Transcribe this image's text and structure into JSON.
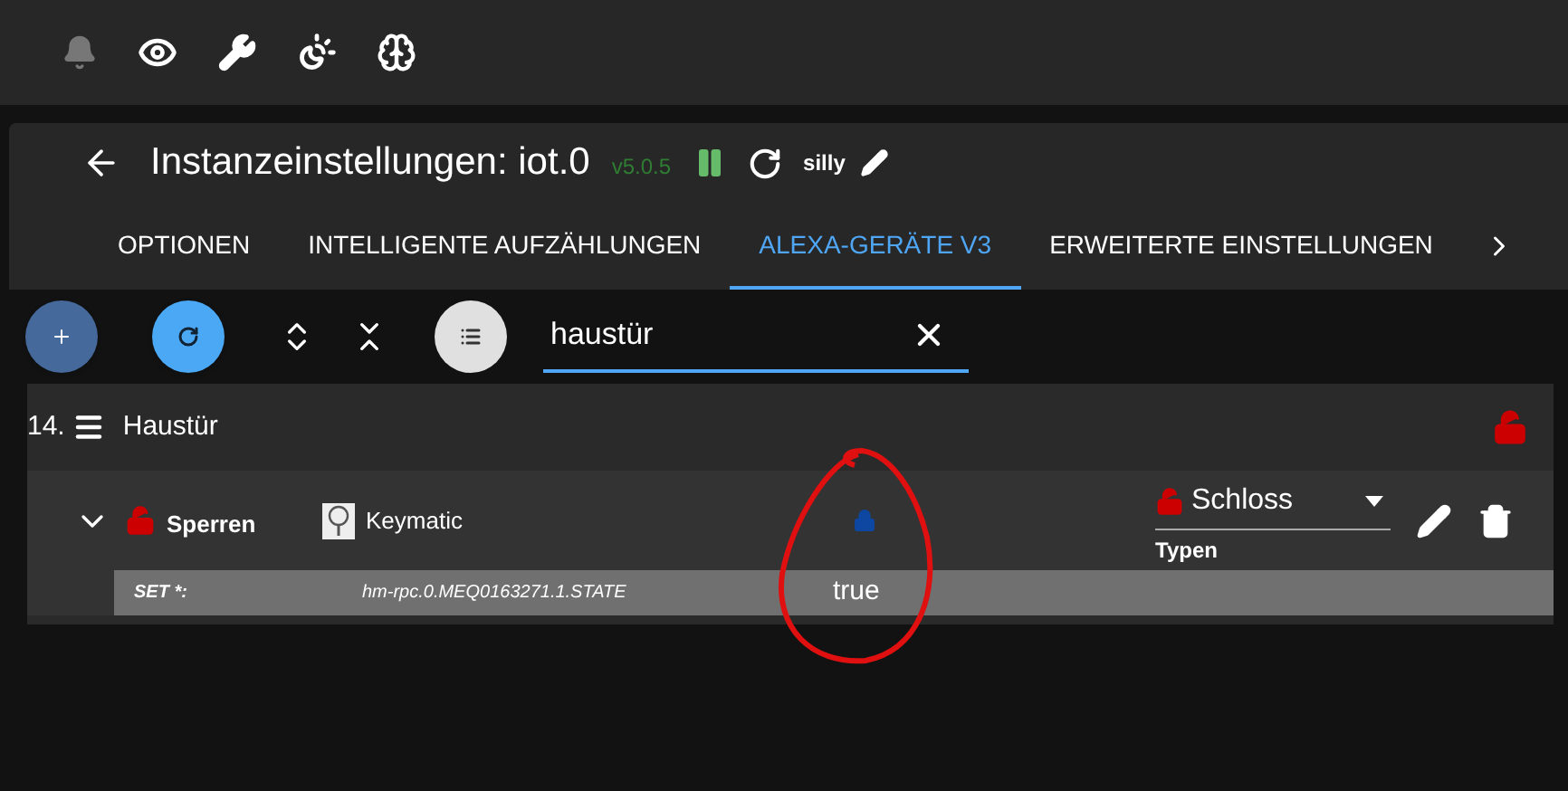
{
  "header": {
    "title": "Instanzeinstellungen: iot.0",
    "version": "v5.0.5",
    "running": true,
    "log_level": "silly"
  },
  "tabs": [
    {
      "label": "OPTIONEN",
      "selected": false
    },
    {
      "label": "INTELLIGENTE AUFZÄHLUNGEN",
      "selected": false
    },
    {
      "label": "ALEXA-GERÄTE V3",
      "selected": true
    },
    {
      "label": "ERWEITERTE EINSTELLUNGEN",
      "selected": false
    }
  ],
  "search": {
    "value": "haustür"
  },
  "group": {
    "number": "14.",
    "name": "Haustür",
    "locked": false,
    "devices": [
      {
        "expanded": true,
        "locked": false,
        "name": "Sperren",
        "type": "Keymatic",
        "value_locked": true,
        "kind_locked": false,
        "kind": "Schloss",
        "kind_label": "Typen",
        "states": [
          {
            "label": "SET *:",
            "id": "hm-rpc.0.MEQ0163271.1.STATE",
            "value": "true"
          }
        ]
      }
    ]
  }
}
